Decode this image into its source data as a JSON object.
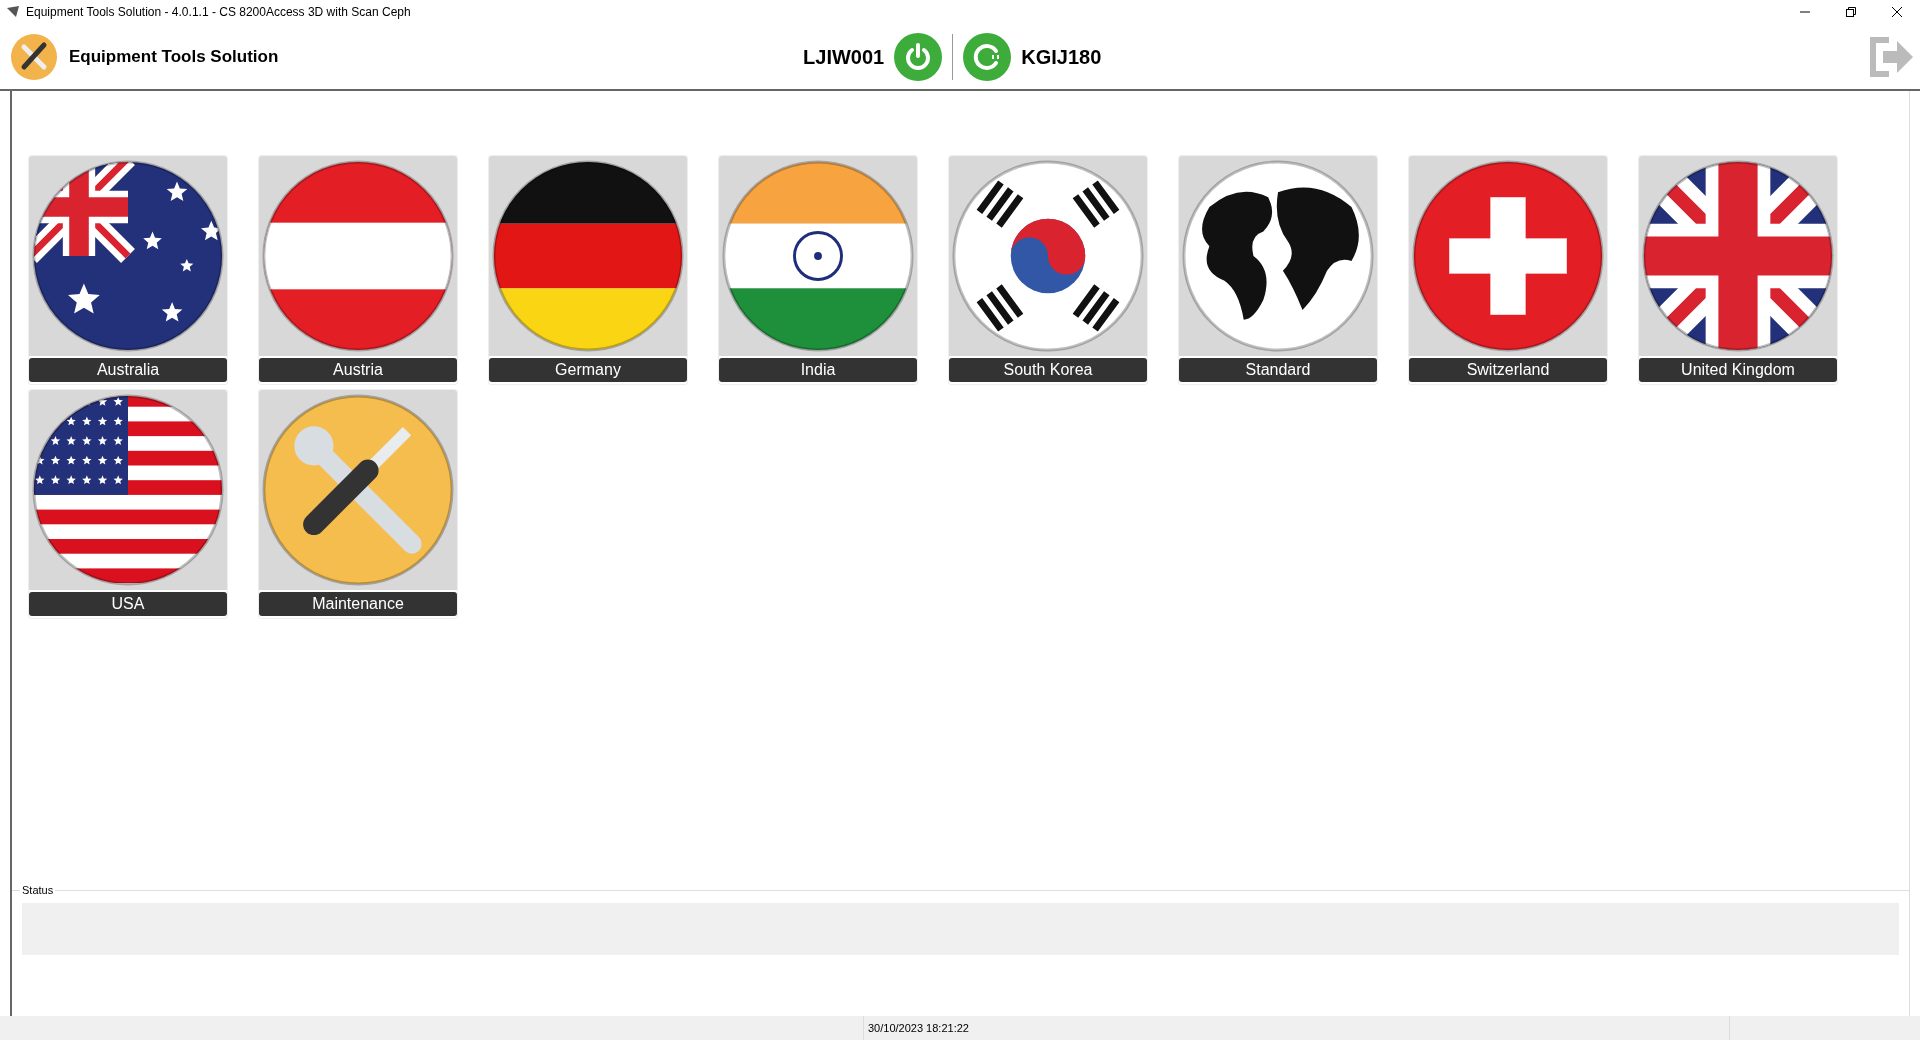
{
  "window": {
    "title": "Equipment Tools Solution - 4.0.1.1 - CS 8200Access 3D with Scan Ceph"
  },
  "header": {
    "app_name": "Equipment Tools Solution",
    "device_id": "LJIW001",
    "station_id": "KGIJ180"
  },
  "tiles": [
    {
      "label": "Australia",
      "kind": "au"
    },
    {
      "label": "Austria",
      "kind": "at"
    },
    {
      "label": "Germany",
      "kind": "de"
    },
    {
      "label": "India",
      "kind": "in"
    },
    {
      "label": "South Korea",
      "kind": "kr"
    },
    {
      "label": "Standard",
      "kind": "world"
    },
    {
      "label": "Switzerland",
      "kind": "ch"
    },
    {
      "label": "United Kingdom",
      "kind": "gb"
    },
    {
      "label": "USA",
      "kind": "us"
    },
    {
      "label": "Maintenance",
      "kind": "tools"
    }
  ],
  "status": {
    "label": "Status"
  },
  "status_bar": {
    "datetime": "30/10/2023 18:21:22"
  }
}
